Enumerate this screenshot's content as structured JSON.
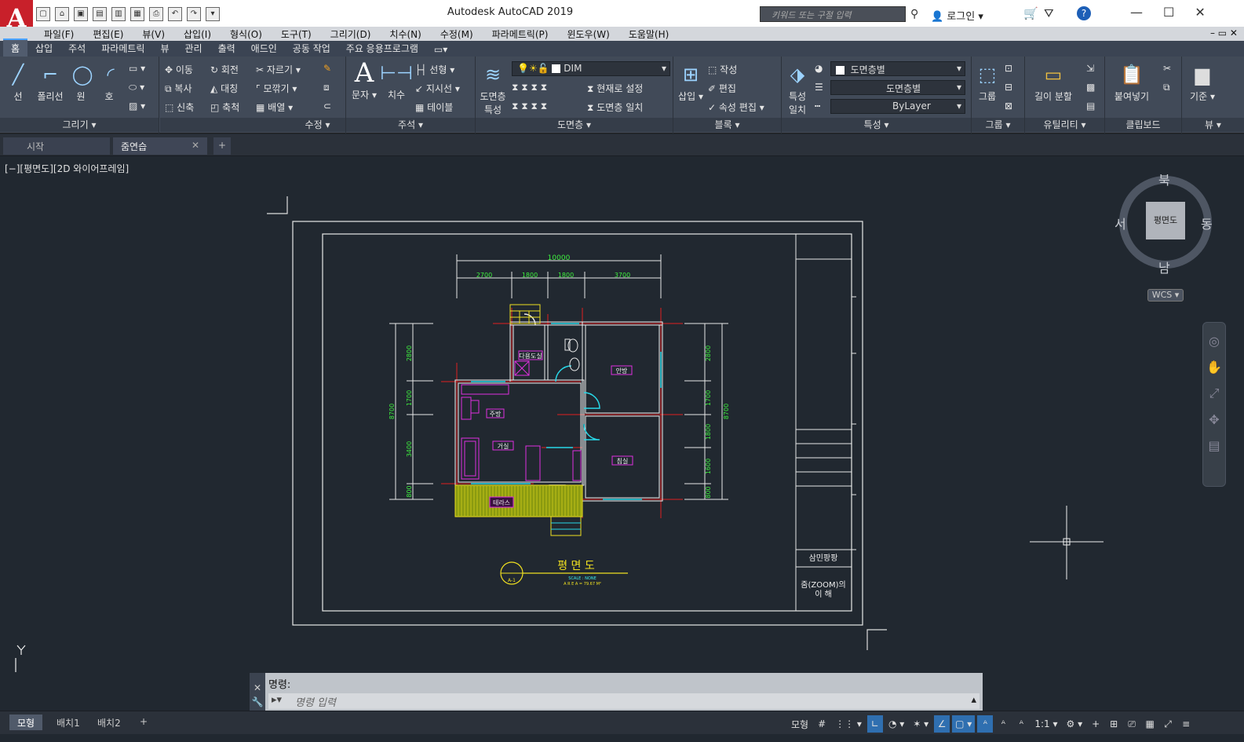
{
  "titlebar": {
    "app_title": "Autodesk AutoCAD 2019",
    "logo": "A",
    "search_placeholder": "키워드 또는 구절 입력",
    "login": "로그인"
  },
  "menu": [
    "파일(F)",
    "편집(E)",
    "뷰(V)",
    "삽입(I)",
    "형식(O)",
    "도구(T)",
    "그리기(D)",
    "치수(N)",
    "수정(M)",
    "파라메트릭(P)",
    "윈도우(W)",
    "도움말(H)"
  ],
  "tabs": [
    "홈",
    "삽입",
    "주석",
    "파라메트릭",
    "뷰",
    "관리",
    "출력",
    "애드인",
    "공동 작업",
    "주요 응용프로그램"
  ],
  "ribbon": {
    "draw": {
      "line": "선",
      "polyline": "폴리선",
      "circle": "원",
      "arc": "호",
      "label": "그리기"
    },
    "modify": {
      "move": "이동",
      "rotate": "회전",
      "trim": "자르기",
      "copy": "복사",
      "mirror": "대칭",
      "fillet": "모깎기",
      "stretch": "신축",
      "scale": "축척",
      "array": "배열",
      "label": "수정"
    },
    "annotation": {
      "text": "문자",
      "dimension": "치수",
      "linear": "선형",
      "leader": "지시선",
      "table": "테이블",
      "label": "주석"
    },
    "layers": {
      "layer_props_1": "도면층",
      "layer_props_2": "특성",
      "current_layer": "DIM",
      "make_current": "현재로 설정",
      "match_layer": "도면층 일치",
      "label": "도면층"
    },
    "block": {
      "insert": "삽입",
      "create": "작성",
      "edit": "편집",
      "attr_edit": "속성 편집",
      "label": "블록"
    },
    "properties": {
      "match_1": "특성",
      "match_2": "일치",
      "color": "도면층별",
      "linetype": "도면층별",
      "lineweight": "ByLayer",
      "label": "특성"
    },
    "groups": {
      "group": "그룹",
      "label": "그룹"
    },
    "utilities": {
      "measure": "길이 분할",
      "label": "유틸리티"
    },
    "clipboard": {
      "paste": "붙여넣기",
      "label": "클립보드"
    },
    "view": {
      "base": "기준",
      "label": "뷰"
    }
  },
  "doctabs": {
    "start": "시작",
    "current": "줌연습"
  },
  "viewport_label": "[−][평면도][2D 와이어프레임]",
  "drawing": {
    "dim_total": "10000",
    "dims_top": [
      "2700",
      "1800",
      "1800",
      "3700"
    ],
    "dims_left": [
      "2800",
      "1700",
      "3400",
      "800"
    ],
    "dim_left_total": "8700",
    "dims_right": [
      "2800",
      "1700",
      "1800",
      "1600",
      "800"
    ],
    "dim_right_total": "8700",
    "rooms": [
      "다용도실",
      "안방",
      "주방",
      "거실",
      "침실",
      "테라스"
    ],
    "title": "평 면 도",
    "scale": "SCALE : NONE",
    "area": "A R E A = 79.67 M²",
    "circle_tag": "A-1",
    "titleblock": {
      "name": "삼민팡팡",
      "desc_1": "줌(ZOOM)의",
      "desc_2": "이 해"
    }
  },
  "viewcube": {
    "north": "북",
    "south": "남",
    "east": "동",
    "west": "서",
    "face": "평면도",
    "wcs": "WCS"
  },
  "command": {
    "history": "명령:",
    "placeholder": "명령 입력"
  },
  "layouts": [
    "모형",
    "배치1",
    "배치2"
  ],
  "statusbar": {
    "model": "모형",
    "scale": "1:1"
  }
}
